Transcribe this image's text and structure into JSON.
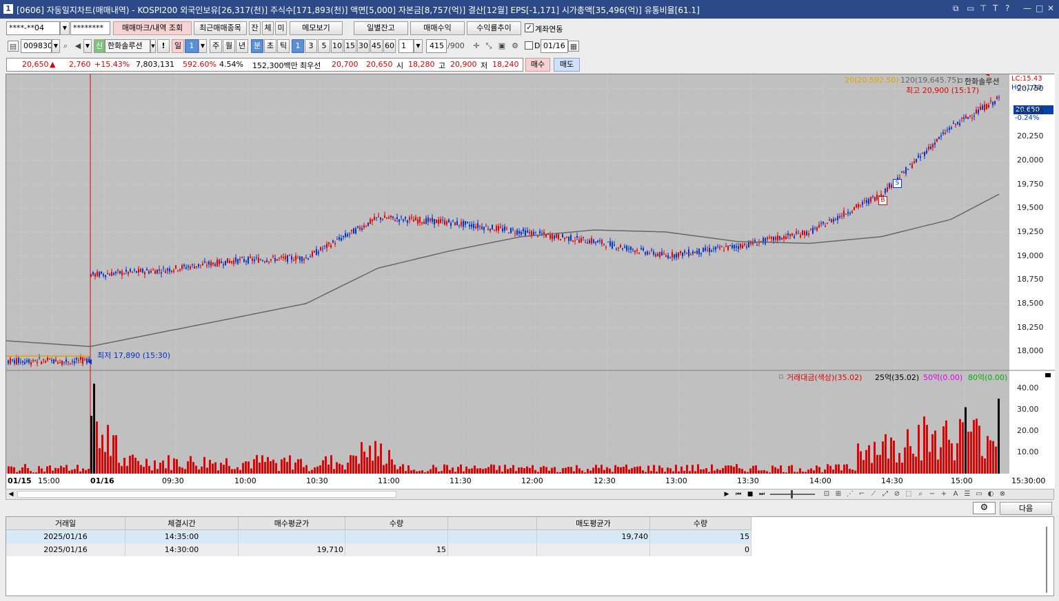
{
  "title": {
    "window_number": "1",
    "text": "[0606] 자동일지차트(매매내역) - KOSPI200 외국인보유[26,317(천)] 주식수[171,893(천)] 액면[5,000] 자본금[8,757(억)] 결산[12월] EPS[-1,171] 시가총액[35,496(억)] 유통비율[61.1]"
  },
  "toolbar1": {
    "account": "****-**04",
    "password": "********",
    "btn_mark": "매매마크/내역 조회",
    "btn_recent": "최근매매종목",
    "btn_jan": "잔",
    "btn_che": "체",
    "btn_mi": "미",
    "btn_memo": "메모보기",
    "btn_daily": "일별잔고",
    "btn_profit": "매매수익",
    "btn_rate": "수익률추이",
    "account_link_label": "계좌연동",
    "account_link_checked": true
  },
  "toolbar2": {
    "code": "009830",
    "sin": "신",
    "name": "한화솔루션",
    "excl": "!",
    "day": "일",
    "day_num": "1",
    "week": "주",
    "month": "월",
    "year": "년",
    "minute": "분",
    "second": "초",
    "tick": "틱",
    "intervals": [
      "1",
      "3",
      "5",
      "10",
      "15",
      "30",
      "45",
      "60"
    ],
    "selected_interval": "1",
    "custom": "1",
    "count": "415",
    "count_max": "/900",
    "d_label": "D",
    "date": "01/16"
  },
  "quote": {
    "price": "20,650",
    "arrow": "▲",
    "change": "2,760",
    "change_pct": "+15.43%",
    "volume": "7,803,131",
    "vol_ratio": "592.60%",
    "turnover": "4.54%",
    "amount": "152,300백만",
    "best_bid_label": "최우선",
    "best_ask": "20,700",
    "best_bid": "20,650",
    "open_label": "시",
    "open": "18,280",
    "high_label": "고",
    "high": "20,900",
    "low_label": "저",
    "low": "18,240",
    "buy": "매수",
    "sell": "매도"
  },
  "price_chart": {
    "legend_ma20": "20(20,592.50)",
    "legend_ma120": "120(19,645.75)",
    "legend_stock": "한화솔루션",
    "lc": "LC:15.43",
    "hc": "HC:-1.20",
    "high_note": "최고 20,900 (15:17)",
    "low_note": "최저 17,890 (15:30)",
    "current_price": "20,650",
    "current_pct": "-0.24%",
    "y_ticks": [
      "20,750",
      "20,500",
      "20,250",
      "20,000",
      "19,750",
      "19,500",
      "19,250",
      "19,000",
      "18,750",
      "18,500",
      "18,250",
      "18,000"
    ],
    "marker_s": "S",
    "marker_b": "B"
  },
  "volume_chart": {
    "legend_main": "거래대금(색상)(35.02)",
    "legend_25": "25억(35.02)",
    "legend_50": "50억(0.00)",
    "legend_80": "80억(0.00)",
    "y_ticks": [
      "40.00",
      "30.00",
      "20.00",
      "10.00"
    ]
  },
  "x_axis": {
    "labels": [
      "01/15",
      "15:00",
      "01/16",
      "09:30",
      "10:00",
      "10:30",
      "11:00",
      "11:30",
      "12:00",
      "12:30",
      "13:00",
      "13:30",
      "14:00",
      "14:30",
      "15:00"
    ],
    "right_label": "15:30:00"
  },
  "table": {
    "next_btn": "다음",
    "columns": [
      "거래일",
      "체결시간",
      "매수평균가",
      "수량",
      "",
      "매도평균가",
      "수량"
    ],
    "rows": [
      {
        "date": "2025/01/16",
        "time": "14:35:00",
        "buy_avg": "",
        "buy_qty": "",
        "blank": "",
        "sell_avg": "19,740",
        "sell_qty": "15"
      },
      {
        "date": "2025/01/16",
        "time": "14:30:00",
        "buy_avg": "19,710",
        "buy_qty": "15",
        "blank": "",
        "sell_avg": "",
        "sell_qty": "0"
      }
    ]
  },
  "chart_data": {
    "type": "line",
    "title": "한화솔루션",
    "x": [
      "01/15 15:00",
      "01/16 09:00",
      "09:30",
      "10:00",
      "10:30",
      "11:00",
      "11:30",
      "12:00",
      "12:30",
      "13:00",
      "13:30",
      "14:00",
      "14:30",
      "15:00",
      "15:20"
    ],
    "series": [
      {
        "name": "한화솔루션",
        "values": [
          17900,
          18800,
          18850,
          18950,
          18980,
          19400,
          19350,
          19250,
          19150,
          19000,
          19100,
          19250,
          19650,
          20350,
          20650
        ]
      },
      {
        "name": "20(20,592.50)",
        "values": [
          17950,
          18300,
          18800,
          18900,
          18950,
          19300,
          19360,
          19270,
          19180,
          19040,
          19060,
          19200,
          19500,
          20150,
          20590
        ]
      },
      {
        "name": "120(19,645.75)",
        "values": [
          18110,
          18050,
          18200,
          18350,
          18500,
          18870,
          19050,
          19200,
          19270,
          19250,
          19150,
          19130,
          19200,
          19380,
          19645
        ]
      }
    ],
    "ylim": [
      17800,
      20900
    ],
    "volume": {
      "type": "bar",
      "ylim": [
        0,
        45
      ]
    }
  }
}
